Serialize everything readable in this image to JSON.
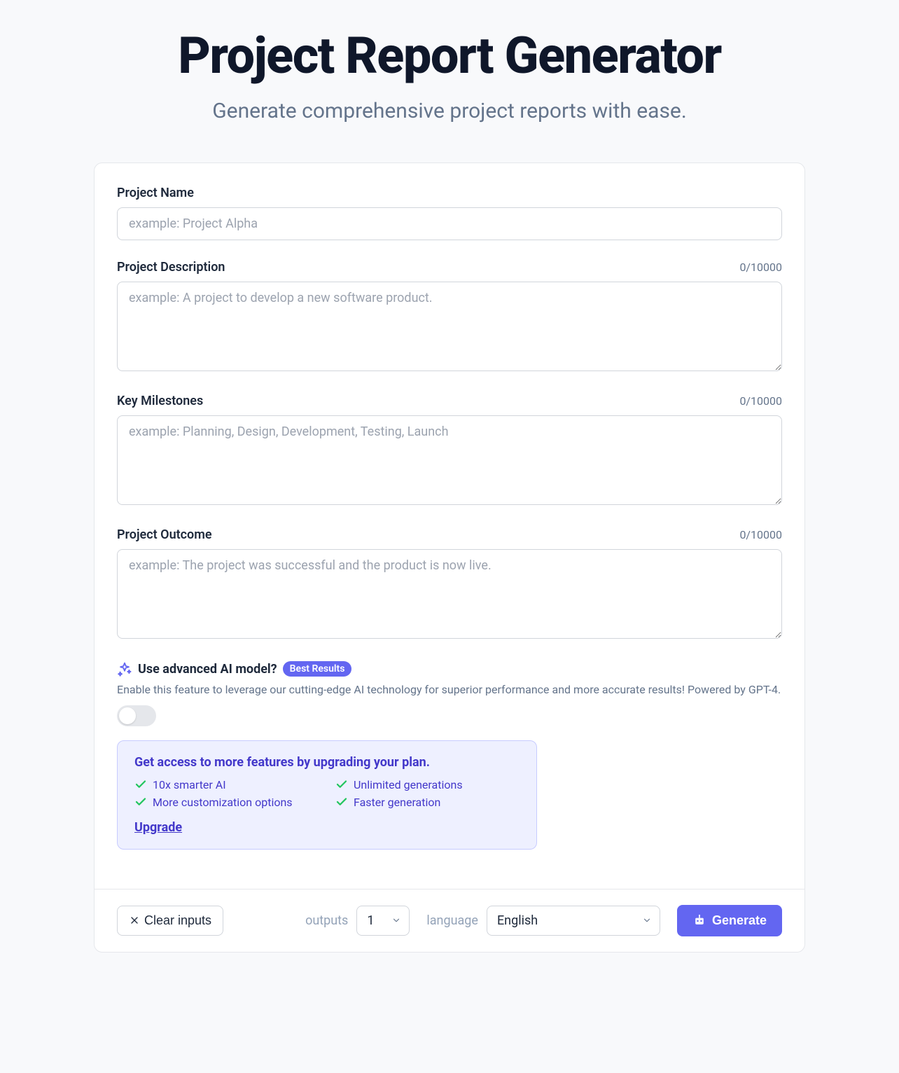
{
  "header": {
    "title": "Project Report Generator",
    "subtitle": "Generate comprehensive project reports with ease."
  },
  "fields": {
    "projectName": {
      "label": "Project Name",
      "placeholder": "example: Project Alpha",
      "value": ""
    },
    "projectDescription": {
      "label": "Project Description",
      "placeholder": "example: A project to develop a new software product.",
      "value": "",
      "counter": "0/10000"
    },
    "keyMilestones": {
      "label": "Key Milestones",
      "placeholder": "example: Planning, Design, Development, Testing, Launch",
      "value": "",
      "counter": "0/10000"
    },
    "projectOutcome": {
      "label": "Project Outcome",
      "placeholder": "example: The project was successful and the product is now live.",
      "value": "",
      "counter": "0/10000"
    }
  },
  "advanced": {
    "title": "Use advanced AI model?",
    "badge": "Best Results",
    "description": "Enable this feature to leverage our cutting-edge AI technology for superior performance and more accurate results! Powered by GPT-4.",
    "enabled": false
  },
  "upgrade": {
    "title": "Get access to more features by upgrading your plan.",
    "features": [
      "10x smarter AI",
      "Unlimited generations",
      "More customization options",
      "Faster generation"
    ],
    "cta": "Upgrade"
  },
  "bottomBar": {
    "clear": "Clear inputs",
    "outputsLabel": "outputs",
    "outputsValue": "1",
    "languageLabel": "language",
    "languageValue": "English",
    "generate": "Generate"
  }
}
